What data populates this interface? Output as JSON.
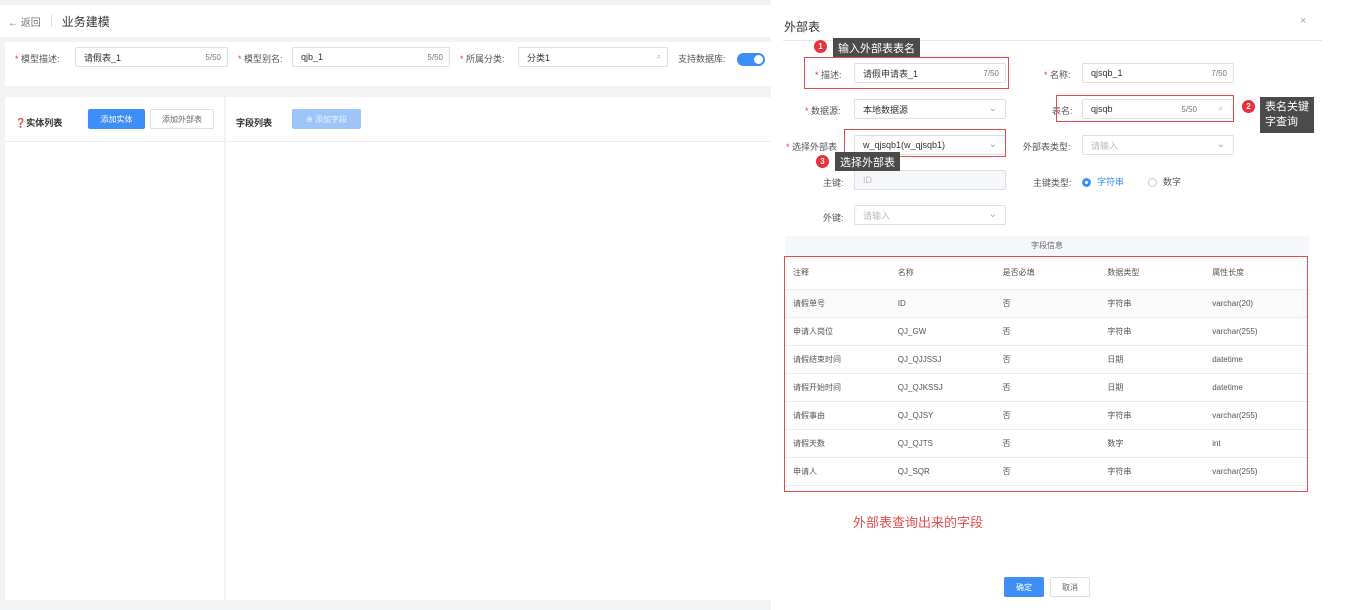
{
  "header": {
    "back_label": "← 返回",
    "title": "业务建模"
  },
  "form": {
    "model_desc_label": "模型描述:",
    "model_desc_value": "请假表_1",
    "model_desc_count": "5/50",
    "model_alias_label": "模型别名:",
    "model_alias_value": "qjb_1",
    "model_alias_count": "5/50",
    "category_label": "所属分类:",
    "category_value": "分类1",
    "db_support_label": "支持数据库:"
  },
  "left_panel": {
    "title": "❓实体列表",
    "add_entity": "添加实体",
    "add_external": "添加外部表"
  },
  "right_panel": {
    "title": "字段列表",
    "add_field": "⊕ 添加字段"
  },
  "drawer": {
    "title": "外部表",
    "close": "×",
    "desc_label": "描述:",
    "desc_value": "请假申请表_1",
    "desc_count": "7/50",
    "name_label": "名称:",
    "name_value": "qjsqb_1",
    "name_count": "7/50",
    "datasource_label": "数据源:",
    "datasource_value": "本地数据源",
    "table_name_label": "表名:",
    "table_name_value": "qjsqb",
    "table_name_count": "5/50",
    "select_table_label": "选择外部表",
    "select_table_value": "w_qjsqb1(w_qjsqb1)",
    "table_type_label": "外部表类型:",
    "table_type_placeholder": "请输入",
    "pk_label": "主键:",
    "pk_placeholder": "ID",
    "pk_type_label": "主键类型:",
    "pk_type_options": [
      "字符串",
      "数字"
    ],
    "fk_label": "外键:",
    "fk_placeholder": "请输入",
    "confirm": "确定",
    "cancel": "取消"
  },
  "table": {
    "caption": "字段信息",
    "headers": [
      "注释",
      "名称",
      "是否必填",
      "数据类型",
      "属性长度"
    ],
    "rows": [
      [
        "请假单号",
        "ID",
        "否",
        "字符串",
        "varchar(20)"
      ],
      [
        "申请人岗位",
        "QJ_GW",
        "否",
        "字符串",
        "varchar(255)"
      ],
      [
        "请假结束时间",
        "QJ_QJJSSJ",
        "否",
        "日期",
        "datetime"
      ],
      [
        "请假开始时间",
        "QJ_QJKSSJ",
        "否",
        "日期",
        "datetime"
      ],
      [
        "请假事由",
        "QJ_QJSY",
        "否",
        "字符串",
        "varchar(255)"
      ],
      [
        "请假天数",
        "QJ_QJTS",
        "否",
        "数字",
        "int"
      ],
      [
        "申请人",
        "QJ_SQR",
        "否",
        "字符串",
        "varchar(255)"
      ]
    ]
  },
  "annotations": {
    "n1": "1",
    "c1": "输入外部表表名",
    "n2": "2",
    "c2a": "表名关键",
    "c2b": "字查询",
    "n3": "3",
    "c3": "选择外部表",
    "note": "外部表查询出来的字段"
  },
  "colors": {
    "primary": "#3e8ef7",
    "annotation_red": "#e74c4c",
    "callout_bg": "#4b4b4b"
  }
}
